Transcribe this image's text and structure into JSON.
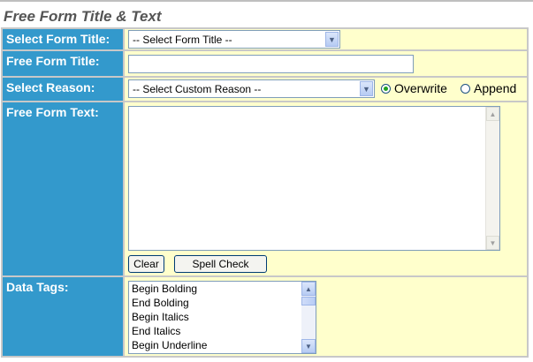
{
  "section_title": "Free Form Title & Text",
  "labels": {
    "select_form_title": "Select Form Title:",
    "free_form_title": "Free Form Title:",
    "select_reason": "Select Reason:",
    "free_form_text": "Free Form Text:",
    "data_tags": "Data Tags:"
  },
  "select_form_title": {
    "value": "-- Select Form Title --"
  },
  "free_form_title": {
    "value": ""
  },
  "select_reason": {
    "value": "-- Select Custom Reason --"
  },
  "mode": {
    "overwrite": "Overwrite",
    "append": "Append",
    "selected": "overwrite"
  },
  "free_form_text": {
    "value": ""
  },
  "buttons": {
    "clear": "Clear",
    "spell_check": "Spell Check"
  },
  "data_tags": [
    "Begin Bolding",
    "End Bolding",
    "Begin Italics",
    "End Italics",
    "Begin Underline"
  ],
  "colors": {
    "label_bg": "#3399cc",
    "value_bg": "#ffffcc",
    "title_text": "#555555"
  }
}
